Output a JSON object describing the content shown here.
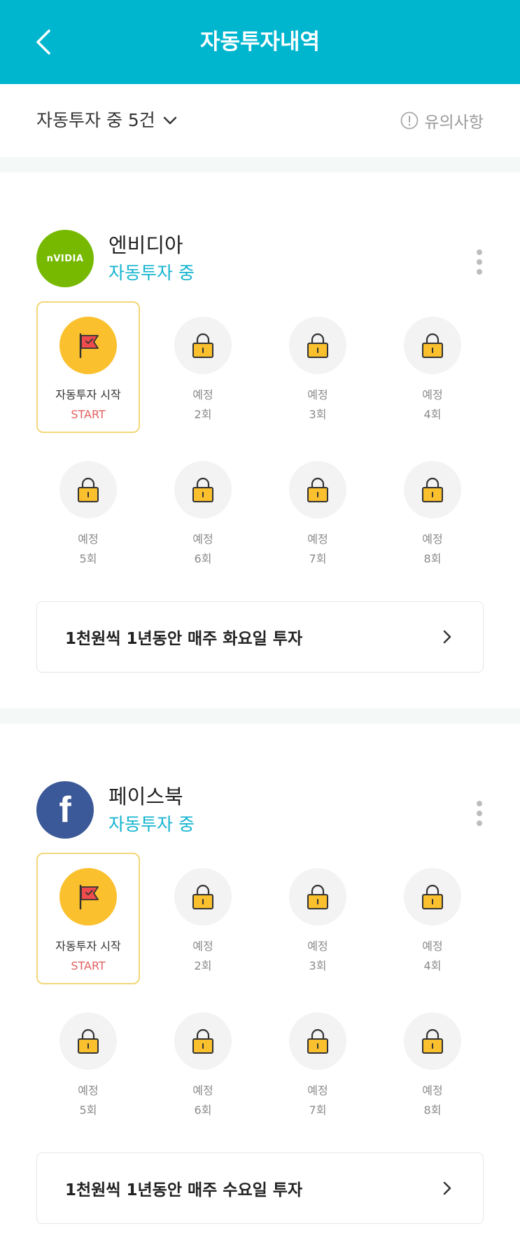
{
  "header": {
    "title": "자동투자내역"
  },
  "filter": {
    "label": "자동투자 중 5건",
    "notice": "유의사항"
  },
  "cards": [
    {
      "name": "엔비디아",
      "logo_text": "nVIDIA",
      "logo_color": "#76b900",
      "status": "자동투자 중",
      "start_title": "자동투자 시작",
      "start_sub": "START",
      "steps": [
        {
          "title": "예정",
          "sub": "2회"
        },
        {
          "title": "예정",
          "sub": "3회"
        },
        {
          "title": "예정",
          "sub": "4회"
        },
        {
          "title": "예정",
          "sub": "5회"
        },
        {
          "title": "예정",
          "sub": "6회"
        },
        {
          "title": "예정",
          "sub": "7회"
        },
        {
          "title": "예정",
          "sub": "8회"
        }
      ],
      "plan": "1천원씩 1년동안 매주 화요일 투자"
    },
    {
      "name": "페이스북",
      "logo_text": "f",
      "logo_color": "#3b5998",
      "status": "자동투자 중",
      "start_title": "자동투자 시작",
      "start_sub": "START",
      "steps": [
        {
          "title": "예정",
          "sub": "2회"
        },
        {
          "title": "예정",
          "sub": "3회"
        },
        {
          "title": "예정",
          "sub": "4회"
        },
        {
          "title": "예정",
          "sub": "5회"
        },
        {
          "title": "예정",
          "sub": "6회"
        },
        {
          "title": "예정",
          "sub": "7회"
        },
        {
          "title": "예정",
          "sub": "8회"
        }
      ],
      "plan": "1천원씩 1년동안 매주 수요일 투자"
    }
  ],
  "colors": {
    "accent": "#00b6cf",
    "status": "#14b4cf",
    "start": "#e26060",
    "flag_circle": "#fbc02d"
  }
}
